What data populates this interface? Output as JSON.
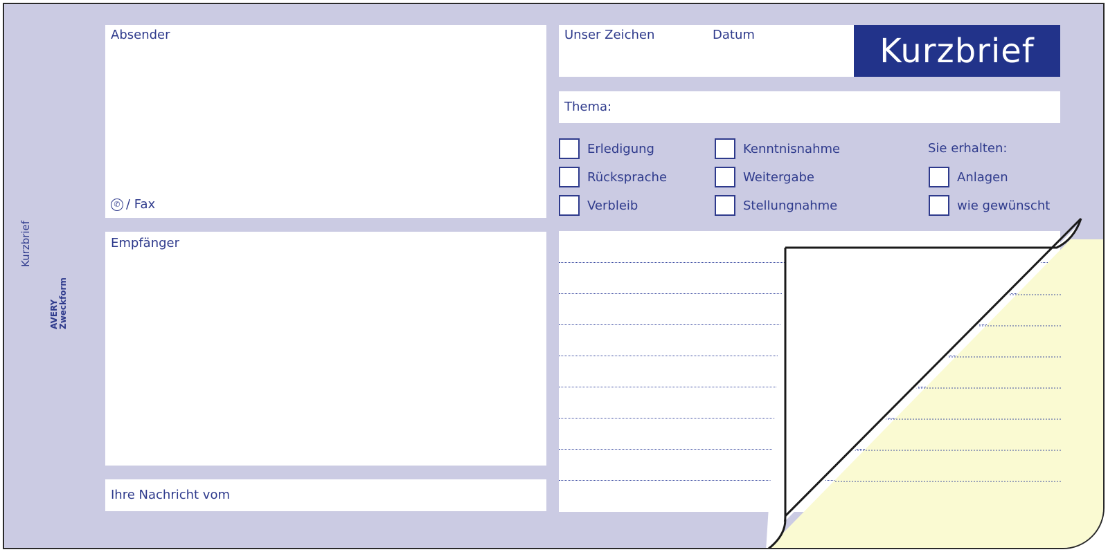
{
  "form": {
    "title": "Kurzbrief",
    "sender_label": "Absender",
    "phone_fax_label": "/ Fax",
    "recipient_label": "Empfänger",
    "your_message_label": "Ihre Nachricht vom",
    "our_ref_label": "Unser Zeichen",
    "date_label": "Datum",
    "topic_label": "Thema:",
    "checkboxes_col1": [
      "Erledigung",
      "Rücksprache",
      "Verbleib"
    ],
    "checkboxes_col2": [
      "Kenntnisnahme",
      "Weitergabe",
      "Stellungnahme"
    ],
    "receive_heading": "Sie erhalten:",
    "checkboxes_col3": [
      "Anlagen",
      "wie gewünscht"
    ],
    "side_title": "Kurzbrief",
    "brand_line1": "AVERY",
    "brand_line2": "Zweckform"
  },
  "colors": {
    "form_background": "#cbcbe3",
    "accent_blue": "#22338a",
    "carbon_copy_yellow": "#fafad2"
  },
  "icons": {
    "phone": "phone-icon"
  }
}
